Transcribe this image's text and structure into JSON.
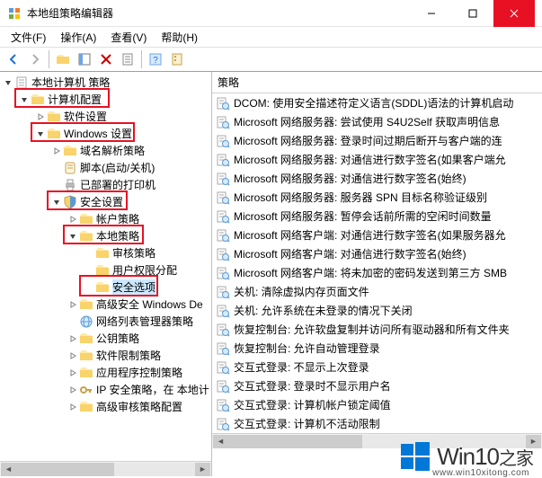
{
  "window": {
    "title": "本地组策略编辑器"
  },
  "menu": {
    "file": "文件(F)",
    "action": "操作(A)",
    "view": "查看(V)",
    "help": "帮助(H)"
  },
  "list": {
    "header": "策略",
    "items": [
      "DCOM: 使用安全描述符定义语言(SDDL)语法的计算机启动",
      "Microsoft 网络服务器: 尝试使用 S4U2Self 获取声明信息",
      "Microsoft 网络服务器: 登录时间过期后断开与客户端的连",
      "Microsoft 网络服务器: 对通信进行数字签名(如果客户端允",
      "Microsoft 网络服务器: 对通信进行数字签名(始终)",
      "Microsoft 网络服务器: 服务器 SPN 目标名称验证级别",
      "Microsoft 网络服务器: 暂停会话前所需的空闲时间数量",
      "Microsoft 网络客户端: 对通信进行数字签名(如果服务器允",
      "Microsoft 网络客户端: 对通信进行数字签名(始终)",
      "Microsoft 网络客户端: 将未加密的密码发送到第三方 SMB",
      "关机: 清除虚拟内存页面文件",
      "关机: 允许系统在未登录的情况下关闭",
      "恢复控制台: 允许软盘复制并访问所有驱动器和所有文件夹",
      "恢复控制台: 允许自动管理登录",
      "交互式登录: 不显示上次登录",
      "交互式登录: 登录时不显示用户名",
      "交互式登录: 计算机帐户锁定阈值",
      "交互式登录: 计算机不活动限制"
    ]
  },
  "tree": {
    "root": "本地计算机 策略",
    "computer_config": "计算机配置",
    "software_settings": "软件设置",
    "windows_settings": "Windows 设置",
    "name_resolution": "域名解析策略",
    "scripts": "脚本(启动/关机)",
    "deployed_printers": "已部署的打印机",
    "security_settings": "安全设置",
    "account_policies": "帐户策略",
    "local_policies": "本地策略",
    "audit_policy": "审核策略",
    "user_rights": "用户权限分配",
    "security_options": "安全选项",
    "windows_defender": "高级安全 Windows De",
    "network_list": "网络列表管理器策略",
    "public_key": "公钥策略",
    "software_restriction": "软件限制策略",
    "app_control": "应用程序控制策略",
    "ip_security": "IP 安全策略，在 本地计",
    "advanced_audit": "高级审核策略配置"
  },
  "watermark": {
    "brand": "Win10",
    "suffix": "之家",
    "url": "www.win10xitong.com"
  }
}
